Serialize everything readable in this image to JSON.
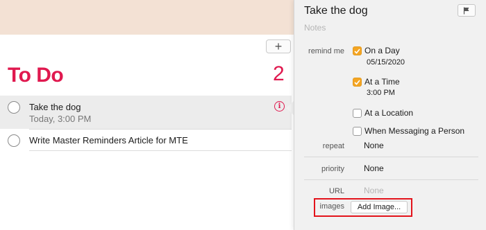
{
  "list": {
    "add_button": "+",
    "title": "To Do",
    "count": "2",
    "items": [
      {
        "title": "Take the dog",
        "subtitle": "Today, 3:00 PM"
      },
      {
        "title": "Write Master Reminders Article for MTE",
        "subtitle": ""
      }
    ]
  },
  "detail": {
    "title": "Take the dog",
    "notes_placeholder": "Notes",
    "remind_me_label": "remind me",
    "on_a_day": {
      "label": "On a Day",
      "checked": true,
      "value": "05/15/2020"
    },
    "at_a_time": {
      "label": "At a Time",
      "checked": true,
      "value": "3:00 PM"
    },
    "at_a_location": {
      "label": "At a Location",
      "checked": false
    },
    "when_messaging": {
      "label": "When Messaging a Person",
      "checked": false
    },
    "repeat_label": "repeat",
    "repeat_value": "None",
    "priority_label": "priority",
    "priority_value": "None",
    "url_label": "URL",
    "url_placeholder": "None",
    "images_label": "images",
    "add_image_label": "Add Image..."
  },
  "colors": {
    "accent": "#e0194f",
    "checkbox_checked": "#f4a523",
    "highlight_box": "#e3131b"
  }
}
